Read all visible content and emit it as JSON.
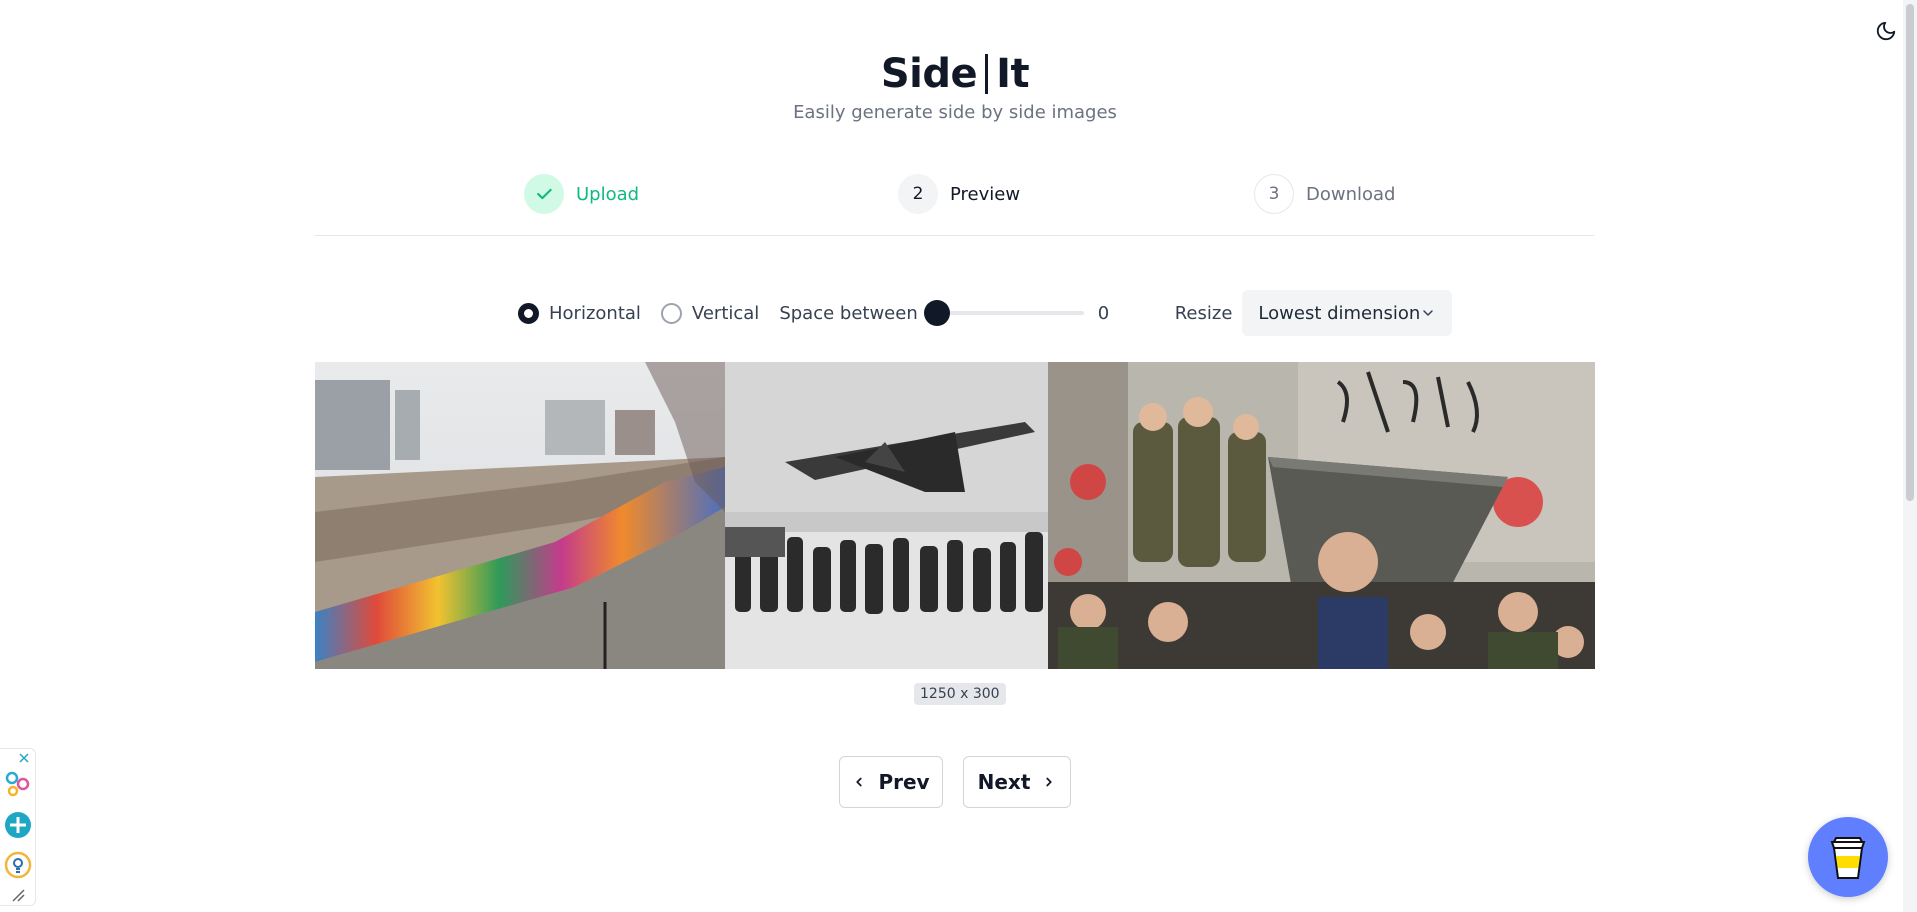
{
  "header": {
    "title_left": "Side",
    "title_right": "It",
    "subtitle": "Easily generate side by side images"
  },
  "steps": [
    {
      "number": "1",
      "label": "Upload",
      "state": "done"
    },
    {
      "number": "2",
      "label": "Preview",
      "state": "current"
    },
    {
      "number": "3",
      "label": "Download",
      "state": "todo"
    }
  ],
  "controls": {
    "orientation_options": [
      "Horizontal",
      "Vertical"
    ],
    "orientation_selected": "Horizontal",
    "space_between_label": "Space between",
    "space_between_value": "0",
    "resize_label": "Resize",
    "resize_selected": "Lowest dimension"
  },
  "preview": {
    "dimensions": "1250 x 300"
  },
  "navigation": {
    "prev_label": "Prev",
    "next_label": "Next"
  },
  "colors": {
    "accent_done": "#10b981",
    "primary": "#111827",
    "coffee": "#5f7fff"
  }
}
